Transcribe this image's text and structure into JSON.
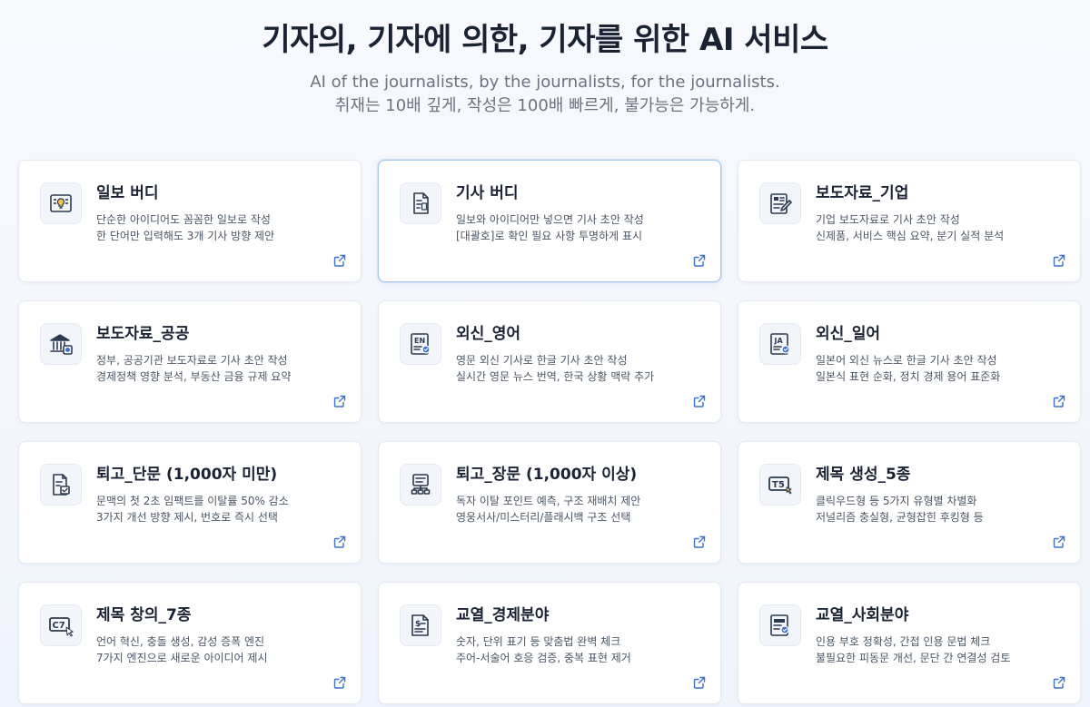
{
  "hero": {
    "title": "기자의, 기자에 의한, 기자를 위한 AI 서비스",
    "subtitle_en": "AI of the journalists, by the journalists, for the journalists.",
    "subtitle_ko": "취재는 10배 깊게, 작성은 100배 빠르게, 불가능은 가능하게."
  },
  "colors": {
    "accent": "#3b6fd1",
    "icon": "#2d3a4f",
    "card_border_active": "#a9c6ee"
  },
  "cards": [
    {
      "title": "일보 버디",
      "desc1": "단순한 아이디어도 꼼꼼한 일보로 작성",
      "desc2": "한 단어만 입력해도 3개 기사 방향 제안",
      "icon": "bulb-doc-icon"
    },
    {
      "title": "기사 버디",
      "desc1": "일보와 아이디어만 넣으면 기사 초안 작성",
      "desc2": "[대괄호]로 확인 필요 사항 투명하게 표시",
      "icon": "bracket-doc-icon"
    },
    {
      "title": "보도자료_기업",
      "desc1": "기업 보도자료로 기사 초안 작성",
      "desc2": "신제품, 서비스 핵심 요약, 분기 실적 분석",
      "icon": "pencil-doc-icon"
    },
    {
      "title": "보도자료_공공",
      "desc1": "정부, 공공기관 보도자료로 기사 초안 작성",
      "desc2": "경제정책 영향 분석, 부동산 금융 규제 요약",
      "icon": "government-building-icon"
    },
    {
      "title": "외신_영어",
      "desc1": "영문 외신 기사로 한글 기사 초안 작성",
      "desc2": "실시간 영문 뉴스 번역, 한국 상황 맥락 추가",
      "icon": "en-doc-icon",
      "badge": "EN"
    },
    {
      "title": "외신_일어",
      "desc1": "일본어 외신 뉴스로 한글 기사 초안 작성",
      "desc2": "일본식 표현 순화, 정치 경제 용어 표준화",
      "icon": "ja-doc-icon",
      "badge": "JA"
    },
    {
      "title": "퇴고_단문 (1,000자 미만)",
      "desc1": "문맥의 첫 2초 임팩트를 이탈률 50% 감소",
      "desc2": "3가지 개선 방향 제시, 번호로 즉시 선택",
      "icon": "check-doc-icon"
    },
    {
      "title": "퇴고_장문 (1,000자 이상)",
      "desc1": "독자 이탈 포인트 예측, 구조 재배치 제안",
      "desc2": "영웅서사/미스터리/플래시백 구조 선택",
      "icon": "structure-doc-icon"
    },
    {
      "title": "제목 생성_5종",
      "desc1": "클릭우드형 등 5가지 유형별 차별화",
      "desc2": "저널리즘 충실형, 균형잡힌 후킹형 등",
      "icon": "t5-cursor-icon",
      "badge": "T5"
    },
    {
      "title": "제목 창의_7종",
      "desc1": "언어 혁신, 충돌 생성, 감성 증폭 엔진",
      "desc2": "7가지 엔진으로 새로운 아이디어 제시",
      "icon": "c7-cursor-icon",
      "badge": "C7"
    },
    {
      "title": "교열_경제분야",
      "desc1": "숫자, 단위 표기 등 맞춤법 완벽 체크",
      "desc2": "주어-서술어 호응 검증, 중복 표현 제거",
      "icon": "dollar-doc-icon",
      "badge": "$"
    },
    {
      "title": "교열_사회분야",
      "desc1": "인용 부호 정확성, 간접 인용 문법 체크",
      "desc2": "불필요한 피동문 개선, 문단 간 연결성 검토",
      "icon": "table-check-doc-icon"
    }
  ]
}
